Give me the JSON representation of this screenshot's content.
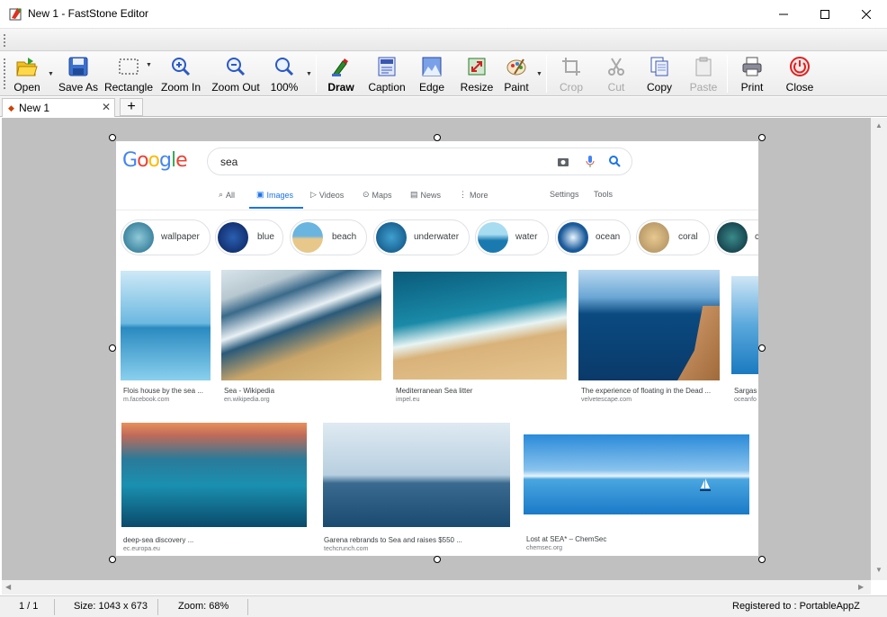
{
  "window": {
    "title": "New 1 - FastStone Editor"
  },
  "toolbar": {
    "open": "Open",
    "save_as": "Save As",
    "rectangle": "Rectangle",
    "zoom_in": "Zoom In",
    "zoom_out": "Zoom Out",
    "zoom_level": "100%",
    "draw": "Draw",
    "caption": "Caption",
    "edge": "Edge",
    "resize": "Resize",
    "paint": "Paint",
    "crop": "Crop",
    "cut": "Cut",
    "copy": "Copy",
    "paste": "Paste",
    "print": "Print",
    "close": "Close"
  },
  "tabs": [
    {
      "label": "New 1"
    }
  ],
  "status": {
    "page": "1 / 1",
    "size": "Size: 1043 x 673",
    "zoom": "Zoom: 68%",
    "registered": "Registered to : PortableAppZ"
  },
  "screenshot": {
    "logo": "Google",
    "query": "sea",
    "nav": [
      "All",
      "Images",
      "Videos",
      "Maps",
      "News",
      "More",
      "Settings",
      "Tools"
    ],
    "chips": [
      "wallpaper",
      "blue",
      "beach",
      "underwater",
      "water",
      "ocean",
      "coral",
      "c"
    ],
    "results": [
      {
        "caption": "Flois house by the sea ...",
        "source": "m.facebook.com"
      },
      {
        "caption": "Sea - Wikipedia",
        "source": "en.wikipedia.org"
      },
      {
        "caption": "Mediterranean Sea litter",
        "source": "impel.eu"
      },
      {
        "caption": "The experience of floating in the Dead ...",
        "source": "velvetescape.com"
      },
      {
        "caption": "Sargas",
        "source": "oceanfo"
      },
      {
        "caption": "deep-sea discovery ...",
        "source": "ec.europa.eu"
      },
      {
        "caption": "Garena rebrands to Sea and raises $550 ...",
        "source": "techcrunch.com"
      },
      {
        "caption": "Lost at SEA* – ChemSec",
        "source": "chemsec.org"
      }
    ]
  },
  "colors": {
    "accent": "#1a73e8",
    "canvas": "#c0c0c0",
    "close_red": "#e02020"
  }
}
